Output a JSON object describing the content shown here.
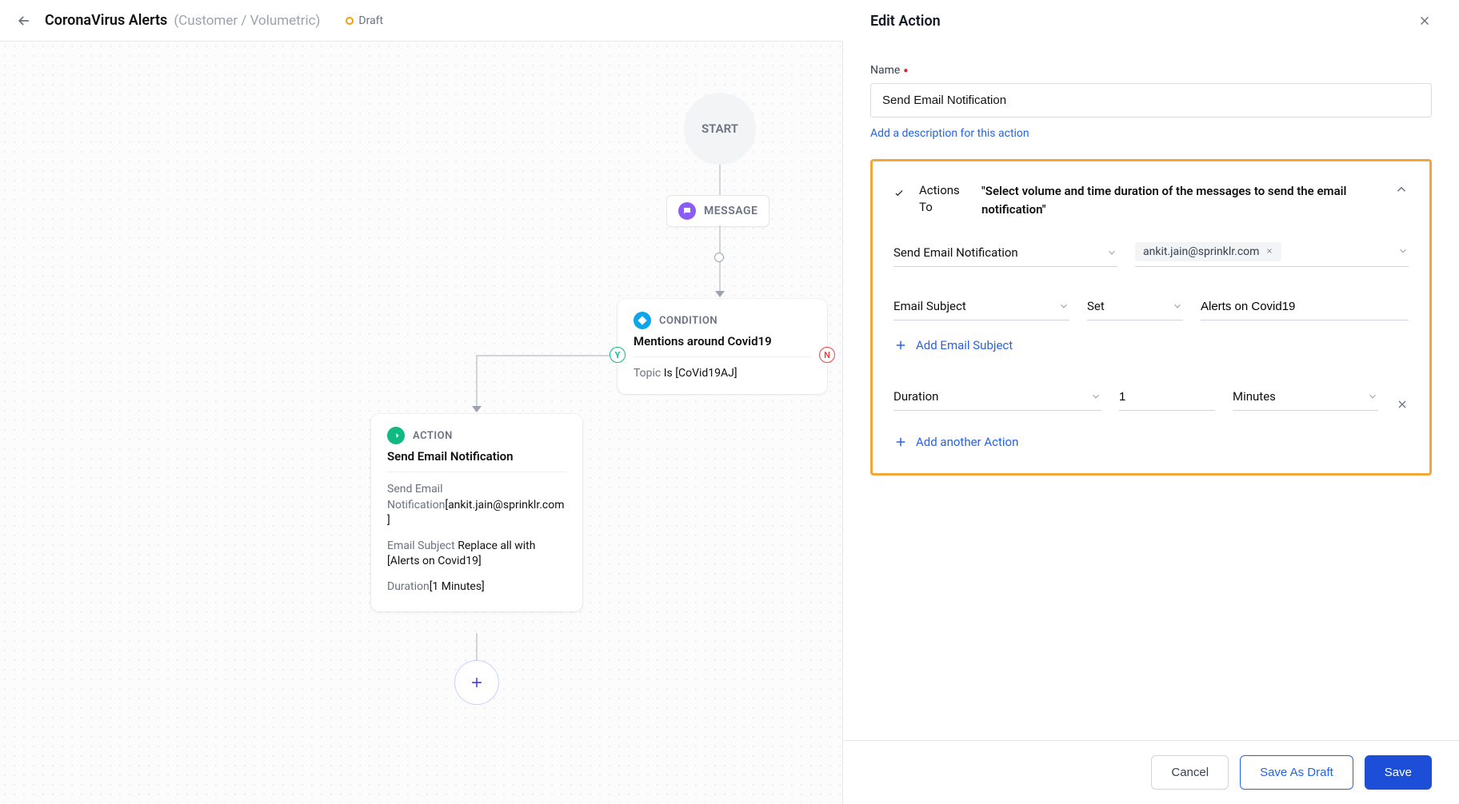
{
  "header": {
    "title": "CoronaVirus Alerts",
    "subtitle": "(Customer / Volumetric)",
    "status": "Draft"
  },
  "canvas": {
    "start_label": "START",
    "message_tag": "MESSAGE",
    "condition": {
      "tag": "CONDITION",
      "title": "Mentions around Covid19",
      "field_label": "Topic",
      "field_value": "Is [CoVid19AJ]"
    },
    "yes_badge": "Y",
    "no_badge": "N",
    "action": {
      "tag": "ACTION",
      "title": "Send Email Notification",
      "line1_label": "Send Email Notification",
      "line1_value": "[ankit.jain@sprinklr.com]",
      "line2_label": "Email Subject",
      "line2_value": "Replace all with [Alerts on Covid19]",
      "line3_label": "Duration",
      "line3_value": "[1 Minutes]"
    }
  },
  "panel": {
    "title": "Edit Action",
    "name_label": "Name",
    "name_value": "Send Email Notification",
    "add_description": "Add a description for this action",
    "actions_to_label_1": "Actions",
    "actions_to_label_2": "To",
    "actions_to_desc": "\"Select volume and time duration of the messages to send the email notification\"",
    "action_type": "Send Email Notification",
    "recipient_chip": "ankit.jain@sprinklr.com",
    "subject_field_label": "Email Subject",
    "subject_op": "Set",
    "subject_value": "Alerts on Covid19",
    "add_email_subject": "Add Email Subject",
    "duration_label": "Duration",
    "duration_value": "1",
    "duration_unit": "Minutes",
    "add_another_action": "Add another Action"
  },
  "footer": {
    "cancel": "Cancel",
    "save_draft": "Save As Draft",
    "save": "Save"
  }
}
